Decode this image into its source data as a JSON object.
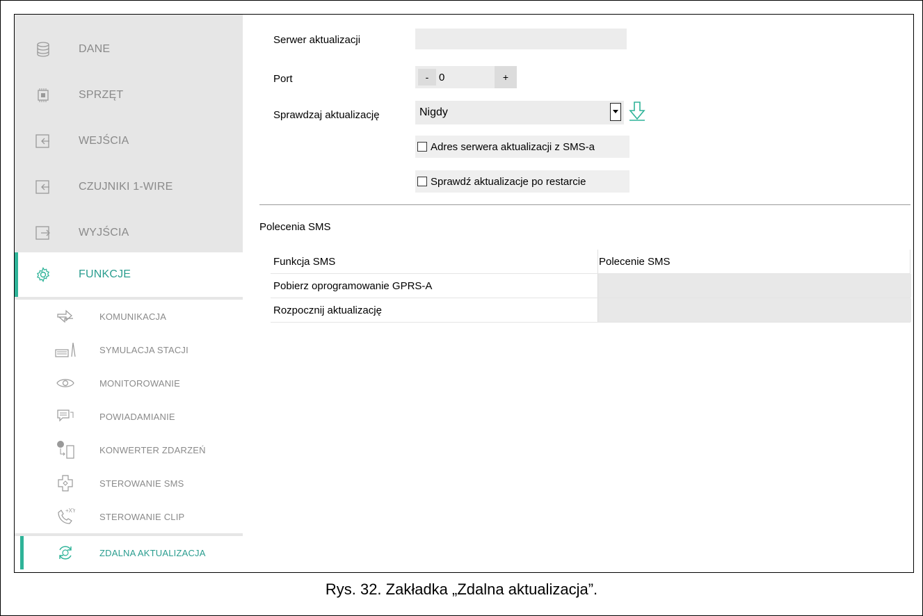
{
  "sidebar": {
    "items": [
      {
        "label": "DANE",
        "icon": "database-icon"
      },
      {
        "label": "SPRZĘT",
        "icon": "chip-icon"
      },
      {
        "label": "WEJŚCIA",
        "icon": "input-icon"
      },
      {
        "label": "CZUJNIKI 1-WIRE",
        "icon": "sensor-icon"
      },
      {
        "label": "WYJŚCIA",
        "icon": "output-icon"
      },
      {
        "label": "FUNKCJE",
        "icon": "gear-icon"
      }
    ],
    "subitems": [
      {
        "label": "KOMUNIKACJA",
        "icon": "communication-icon"
      },
      {
        "label": "SYMULACJA STACJI",
        "icon": "station-icon"
      },
      {
        "label": "MONITOROWANIE",
        "icon": "eye-icon"
      },
      {
        "label": "POWIADAMIANIE",
        "icon": "chat-icon"
      },
      {
        "label": "KONWERTER ZDARZEŃ",
        "icon": "converter-icon"
      },
      {
        "label": "STEROWANIE SMS",
        "icon": "sms-control-icon"
      },
      {
        "label": "STEROWANIE CLIP",
        "icon": "phone-icon"
      },
      {
        "label": "ZDALNA AKTUALIZACJA",
        "icon": "refresh-icon"
      }
    ]
  },
  "form": {
    "server_label": "Serwer aktualizacji",
    "server_value": "",
    "port_label": "Port",
    "port_minus": "-",
    "port_value": "0",
    "port_plus": "+",
    "check_label": "Sprawdzaj aktualizację",
    "check_value": "Nigdy",
    "sms_address_label": "Adres serwera aktualizacji z SMS-a",
    "sms_address_checked": false,
    "restart_label": "Sprawdź aktualizacje po restarcie",
    "restart_checked": false
  },
  "sms": {
    "title": "Polecenia SMS",
    "headers": [
      "Funkcja SMS",
      "Polecenie SMS"
    ],
    "rows": [
      [
        "Pobierz oprogramowanie GPRS-A",
        ""
      ],
      [
        "Rozpocznij aktualizację",
        ""
      ]
    ]
  },
  "caption": "Rys. 32. Zakładka „Zdalna aktualizacja”.",
  "colors": {
    "accent": "#2eb398",
    "sidebar_bg": "#e6e6e6"
  }
}
